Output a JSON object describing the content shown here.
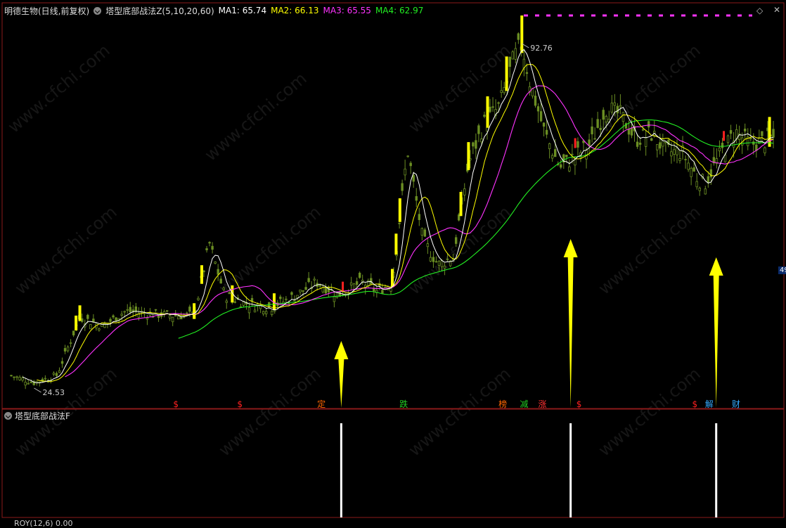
{
  "header": {
    "stock": "明德生物(日线,前复权)",
    "indicator": "塔型底部战法Z(5,10,20,60)",
    "ma1": "MA1: 65.74",
    "ma2": "MA2: 66.13",
    "ma3": "MA3: 65.55",
    "ma4": "MA4: 62.97"
  },
  "sub_header": {
    "name": "塔型底部战法F"
  },
  "bottom_label": "ROY(12,6)  0.00",
  "right_tag": "49",
  "watermark": "www.cfchi.com",
  "colors": {
    "ma1": "#ffffff",
    "ma2": "#ffff00",
    "ma3": "#ff33ff",
    "ma4": "#22ee22",
    "candle": "#6b8e23",
    "signal_up": "#ffff00",
    "marker_red": "#ff2020"
  },
  "chart_data": {
    "type": "candlestick",
    "high_label": "92.76",
    "low_label": "24.53",
    "price_range": [
      24.53,
      92.76
    ],
    "price_path": [
      [
        0,
        27.0
      ],
      [
        0.03,
        25.6
      ],
      [
        0.06,
        27.1
      ],
      [
        0.09,
        38.6
      ],
      [
        0.12,
        36.8
      ],
      [
        0.15,
        39.8
      ],
      [
        0.18,
        39.3
      ],
      [
        0.21,
        38.9
      ],
      [
        0.24,
        39.0
      ],
      [
        0.26,
        53.2
      ],
      [
        0.28,
        42.9
      ],
      [
        0.31,
        41.2
      ],
      [
        0.34,
        40.5
      ],
      [
        0.37,
        42.6
      ],
      [
        0.4,
        45.5
      ],
      [
        0.43,
        43.0
      ],
      [
        0.46,
        45.6
      ],
      [
        0.48,
        43.7
      ],
      [
        0.5,
        45.4
      ],
      [
        0.52,
        71.8
      ],
      [
        0.54,
        54.0
      ],
      [
        0.56,
        49.0
      ],
      [
        0.58,
        50.5
      ],
      [
        0.6,
        69.1
      ],
      [
        0.62,
        76.8
      ],
      [
        0.64,
        80.2
      ],
      [
        0.66,
        90.0
      ],
      [
        0.67,
        92.76
      ],
      [
        0.68,
        85.5
      ],
      [
        0.7,
        75.0
      ],
      [
        0.72,
        68.2
      ],
      [
        0.74,
        70.5
      ],
      [
        0.76,
        72.8
      ],
      [
        0.78,
        80.1
      ],
      [
        0.8,
        78.5
      ],
      [
        0.82,
        73.8
      ],
      [
        0.84,
        74.9
      ],
      [
        0.86,
        71.3
      ],
      [
        0.88,
        71.3
      ],
      [
        0.9,
        66.1
      ],
      [
        0.91,
        65.0
      ],
      [
        0.93,
        70.7
      ],
      [
        0.95,
        75.3
      ],
      [
        0.97,
        72.8
      ],
      [
        1.0,
        74.0
      ]
    ],
    "signal_text_markers": [
      {
        "label": "$",
        "pos": 0.216
      },
      {
        "label": "$",
        "pos": 0.3
      },
      {
        "label": "定",
        "pos": 0.407
      },
      {
        "label": "跌",
        "pos": 0.515
      },
      {
        "label": "榜",
        "pos": 0.645
      },
      {
        "label": "减",
        "pos": 0.673
      },
      {
        "label": "涨",
        "pos": 0.697
      },
      {
        "label": "$",
        "pos": 0.745
      },
      {
        "label": "$",
        "pos": 0.897
      },
      {
        "label": "解",
        "pos": 0.916
      },
      {
        "label": "财",
        "pos": 0.951
      }
    ],
    "arrows": [
      {
        "pos": 0.433
      },
      {
        "pos": 0.734
      },
      {
        "pos": 0.925
      }
    ],
    "sub_chart_bars": [
      {
        "pos": 0.433,
        "value": 1
      },
      {
        "pos": 0.734,
        "value": 1
      },
      {
        "pos": 0.925,
        "value": 1
      }
    ]
  }
}
